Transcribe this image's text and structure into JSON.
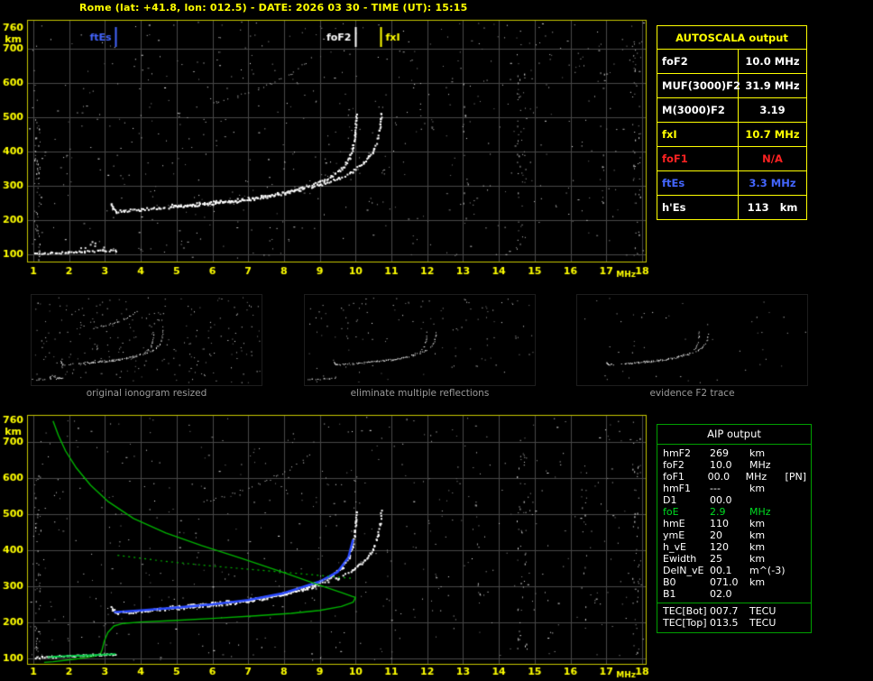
{
  "title": "Rome (lat: +41.8, lon: 012.5) - DATE: 2026 03 30 - TIME (UT): 15:15",
  "text_colors": {
    "white": "#ffffff",
    "yellow": "#ffff00",
    "red": "#ff2222",
    "blue": "#4466ff",
    "green": "#00dd22"
  },
  "colors": {
    "background": "#000000",
    "axis_labels": "#ffff00",
    "plot_border": "#c9c900",
    "grid": "#484848",
    "trace": "#ffffff",
    "profile_green": "#00b400",
    "fit_blue": "#2b4bff",
    "fit_es_green": "#00cc44",
    "caption_gray": "#9a9a9a",
    "autoscala_border": "#ffff00",
    "aip_border": "#00a000"
  },
  "autoscala_table": {
    "header": "AUTOSCALA output",
    "rows": [
      {
        "label": "foF2",
        "value": "10.0 MHz",
        "color": "white"
      },
      {
        "label": "MUF(3000)F2",
        "value": "31.9 MHz",
        "color": "white"
      },
      {
        "label": "M(3000)F2",
        "value": "3.19",
        "color": "white"
      },
      {
        "label": "fxI",
        "value": "10.7 MHz",
        "color": "yellow"
      },
      {
        "label": "foF1",
        "value": "N/A",
        "color": "red"
      },
      {
        "label": "ftEs",
        "value": "3.3 MHz",
        "color": "blue"
      },
      {
        "label": "h'Es",
        "value": "113   km",
        "color": "white"
      }
    ]
  },
  "aip_table": {
    "header": "AIP output",
    "rows": [
      {
        "name": "hmF2",
        "value": "269",
        "unit": "km",
        "color": "white"
      },
      {
        "name": "foF2",
        "value": "10.0",
        "unit": "MHz",
        "color": "white"
      },
      {
        "name": "foF1",
        "value": "00.0",
        "unit": "MHz",
        "extra": "[PN]",
        "color": "white"
      },
      {
        "name": "hmF1",
        "value": "---",
        "unit": "km",
        "color": "white"
      },
      {
        "name": "D1",
        "value": "00.0",
        "unit": "",
        "color": "white"
      },
      {
        "name": "foE",
        "value": "2.9",
        "unit": "MHz",
        "color": "green"
      },
      {
        "name": "hmE",
        "value": "110",
        "unit": "km",
        "color": "white"
      },
      {
        "name": "ymE",
        "value": "20",
        "unit": "km",
        "color": "white"
      },
      {
        "name": "h_vE",
        "value": "120",
        "unit": "km",
        "color": "white"
      },
      {
        "name": "Ewidth",
        "value": "25",
        "unit": "km",
        "color": "white"
      },
      {
        "name": "DelN_vE",
        "value": "00.1",
        "unit": "m^(-3)",
        "color": "white"
      },
      {
        "name": "B0",
        "value": "071.0",
        "unit": "km",
        "color": "white"
      },
      {
        "name": "B1",
        "value": "02.0",
        "unit": "",
        "color": "white"
      }
    ],
    "tec_rows": [
      {
        "name": "TEC[Bot]",
        "value": "007.7",
        "unit": "TECU",
        "color": "white"
      },
      {
        "name": "TEC[Top]",
        "value": "013.5",
        "unit": "TECU",
        "color": "white"
      }
    ]
  },
  "thumbnails": [
    {
      "caption": "original ionogram resized",
      "series": [
        "Es-trace",
        "Es-patch",
        "F2-ordinary",
        "F2-extraordinary",
        "second-hop"
      ],
      "noise": 240
    },
    {
      "caption": "eliminate multiple reflections",
      "series": [
        "Es-trace",
        "F2-ordinary",
        "F2-extraordinary"
      ],
      "noise": 120
    },
    {
      "caption": "evidence F2 trace",
      "series": [
        "F2-ordinary",
        "F2-extraordinary"
      ],
      "noise": 45
    }
  ],
  "chart_data": [
    {
      "type": "scatter",
      "name": "ionogram-top",
      "xlabel": "MHz",
      "ylabel": "km",
      "xlim": [
        1,
        18
      ],
      "ylim": [
        100,
        760
      ],
      "xticks": [
        1,
        2,
        3,
        4,
        5,
        6,
        7,
        8,
        9,
        10,
        11,
        12,
        13,
        14,
        15,
        16,
        17,
        18
      ],
      "yticks": [
        760,
        700,
        600,
        500,
        400,
        300,
        200,
        100
      ],
      "grid": true,
      "markers": [
        {
          "label": "ftEs",
          "freq": 3.3,
          "color": "blue",
          "label_side": "left"
        },
        {
          "label": "foF2",
          "freq": 10.0,
          "color": "white",
          "label_side": "left"
        },
        {
          "label": "fxI",
          "freq": 10.7,
          "color": "yellow",
          "label_side": "right"
        }
      ],
      "series": [
        {
          "name": "Es-trace",
          "color": "#ffffff",
          "points": [
            [
              1.05,
              104
            ],
            [
              1.5,
              106
            ],
            [
              1.95,
              108
            ],
            [
              2.4,
              110
            ],
            [
              2.8,
              112
            ],
            [
              3.1,
              113
            ],
            [
              3.3,
              113
            ]
          ]
        },
        {
          "name": "Es-patch",
          "color": "#ffffff",
          "points": [
            [
              2.3,
              126
            ],
            [
              2.5,
              134
            ],
            [
              2.7,
              130
            ],
            [
              2.9,
              120
            ],
            [
              3.0,
              115
            ]
          ]
        },
        {
          "name": "F2-ordinary",
          "color": "#ffffff",
          "points": [
            [
              3.15,
              252
            ],
            [
              3.2,
              238
            ],
            [
              3.3,
              227
            ],
            [
              3.5,
              229
            ],
            [
              4.0,
              233
            ],
            [
              4.5,
              237
            ],
            [
              5.0,
              241
            ],
            [
              5.5,
              245
            ],
            [
              6.0,
              250
            ],
            [
              6.5,
              255
            ],
            [
              7.0,
              262
            ],
            [
              7.5,
              270
            ],
            [
              8.0,
              281
            ],
            [
              8.5,
              295
            ],
            [
              9.0,
              313
            ],
            [
              9.3,
              328
            ],
            [
              9.6,
              352
            ],
            [
              9.8,
              380
            ],
            [
              9.9,
              410
            ],
            [
              9.97,
              455
            ],
            [
              10.0,
              510
            ]
          ]
        },
        {
          "name": "F2-extraordinary",
          "color": "#ffffff",
          "points": [
            [
              4.8,
              244
            ],
            [
              5.5,
              249
            ],
            [
              6.2,
              256
            ],
            [
              7.0,
              265
            ],
            [
              7.7,
              276
            ],
            [
              8.4,
              290
            ],
            [
              9.0,
              306
            ],
            [
              9.5,
              324
            ],
            [
              9.9,
              345
            ],
            [
              10.2,
              368
            ],
            [
              10.45,
              398
            ],
            [
              10.6,
              438
            ],
            [
              10.67,
              478
            ],
            [
              10.7,
              515
            ]
          ]
        },
        {
          "name": "second-hop",
          "color": "#cfcfcf",
          "points": [
            [
              5.55,
              528
            ],
            [
              6.1,
              545
            ],
            [
              6.7,
              563
            ],
            [
              7.3,
              585
            ],
            [
              7.8,
              608
            ],
            [
              8.2,
              630
            ],
            [
              8.5,
              652
            ],
            [
              8.75,
              672
            ]
          ]
        }
      ]
    },
    {
      "type": "scatter",
      "name": "ionogram-bottom",
      "xlabel": "MHz",
      "ylabel": "km",
      "xlim": [
        1,
        18
      ],
      "ylim": [
        100,
        760
      ],
      "xticks": [
        1,
        2,
        3,
        4,
        5,
        6,
        7,
        8,
        9,
        10,
        11,
        12,
        13,
        14,
        15,
        16,
        17,
        18
      ],
      "yticks": [
        760,
        700,
        600,
        500,
        400,
        300,
        200,
        100
      ],
      "grid": true,
      "series_ref": "ionogram-top",
      "overlays": [
        {
          "name": "fitted-o-trace",
          "color": "#2b4bff",
          "width": 2.6,
          "style": "solid",
          "points": [
            [
              3.25,
              228
            ],
            [
              4.0,
              233
            ],
            [
              5.0,
              241
            ],
            [
              6.0,
              250
            ],
            [
              7.0,
              262
            ],
            [
              8.0,
              281
            ],
            [
              9.0,
              313
            ],
            [
              9.5,
              340
            ],
            [
              9.8,
              380
            ],
            [
              9.93,
              430
            ]
          ]
        },
        {
          "name": "fitted-es-trace",
          "color": "#00cc44",
          "width": 2,
          "style": "solid",
          "points": [
            [
              1.4,
              104
            ],
            [
              2.0,
              107
            ],
            [
              2.6,
              109
            ],
            [
              3.1,
              111
            ],
            [
              3.3,
              112
            ]
          ]
        },
        {
          "name": "electron-density-profile",
          "color": "#00b400",
          "width": 1.4,
          "style": "solid",
          "points": [
            [
              1.55,
              758
            ],
            [
              1.7,
              718
            ],
            [
              1.9,
              675
            ],
            [
              2.2,
              628
            ],
            [
              2.6,
              580
            ],
            [
              3.1,
              534
            ],
            [
              3.8,
              488
            ],
            [
              4.7,
              448
            ],
            [
              5.7,
              413
            ],
            [
              6.8,
              378
            ],
            [
              8.0,
              338
            ],
            [
              9.0,
              303
            ],
            [
              9.6,
              283
            ],
            [
              9.9,
              272
            ],
            [
              10.0,
              269
            ],
            [
              9.93,
              256
            ],
            [
              9.6,
              244
            ],
            [
              9.0,
              233
            ],
            [
              8.2,
              225
            ],
            [
              7.2,
              218
            ],
            [
              6.0,
              211
            ],
            [
              4.9,
              205
            ],
            [
              4.0,
              201
            ],
            [
              3.5,
              197
            ],
            [
              3.25,
              190
            ],
            [
              3.08,
              172
            ],
            [
              2.98,
              148
            ],
            [
              2.92,
              124
            ],
            [
              2.87,
              112
            ],
            [
              2.7,
              106
            ],
            [
              2.3,
              100
            ],
            [
              1.9,
              95
            ],
            [
              1.55,
              91
            ],
            [
              1.3,
              89
            ]
          ]
        },
        {
          "name": "profile-topside-dotted",
          "color": "#00b400",
          "width": 1.2,
          "style": "dotted",
          "points": [
            [
              3.35,
              386
            ],
            [
              4.6,
              370
            ],
            [
              6.0,
              356
            ],
            [
              7.4,
              344
            ],
            [
              8.8,
              332
            ],
            [
              9.9,
              322
            ]
          ]
        }
      ]
    }
  ]
}
